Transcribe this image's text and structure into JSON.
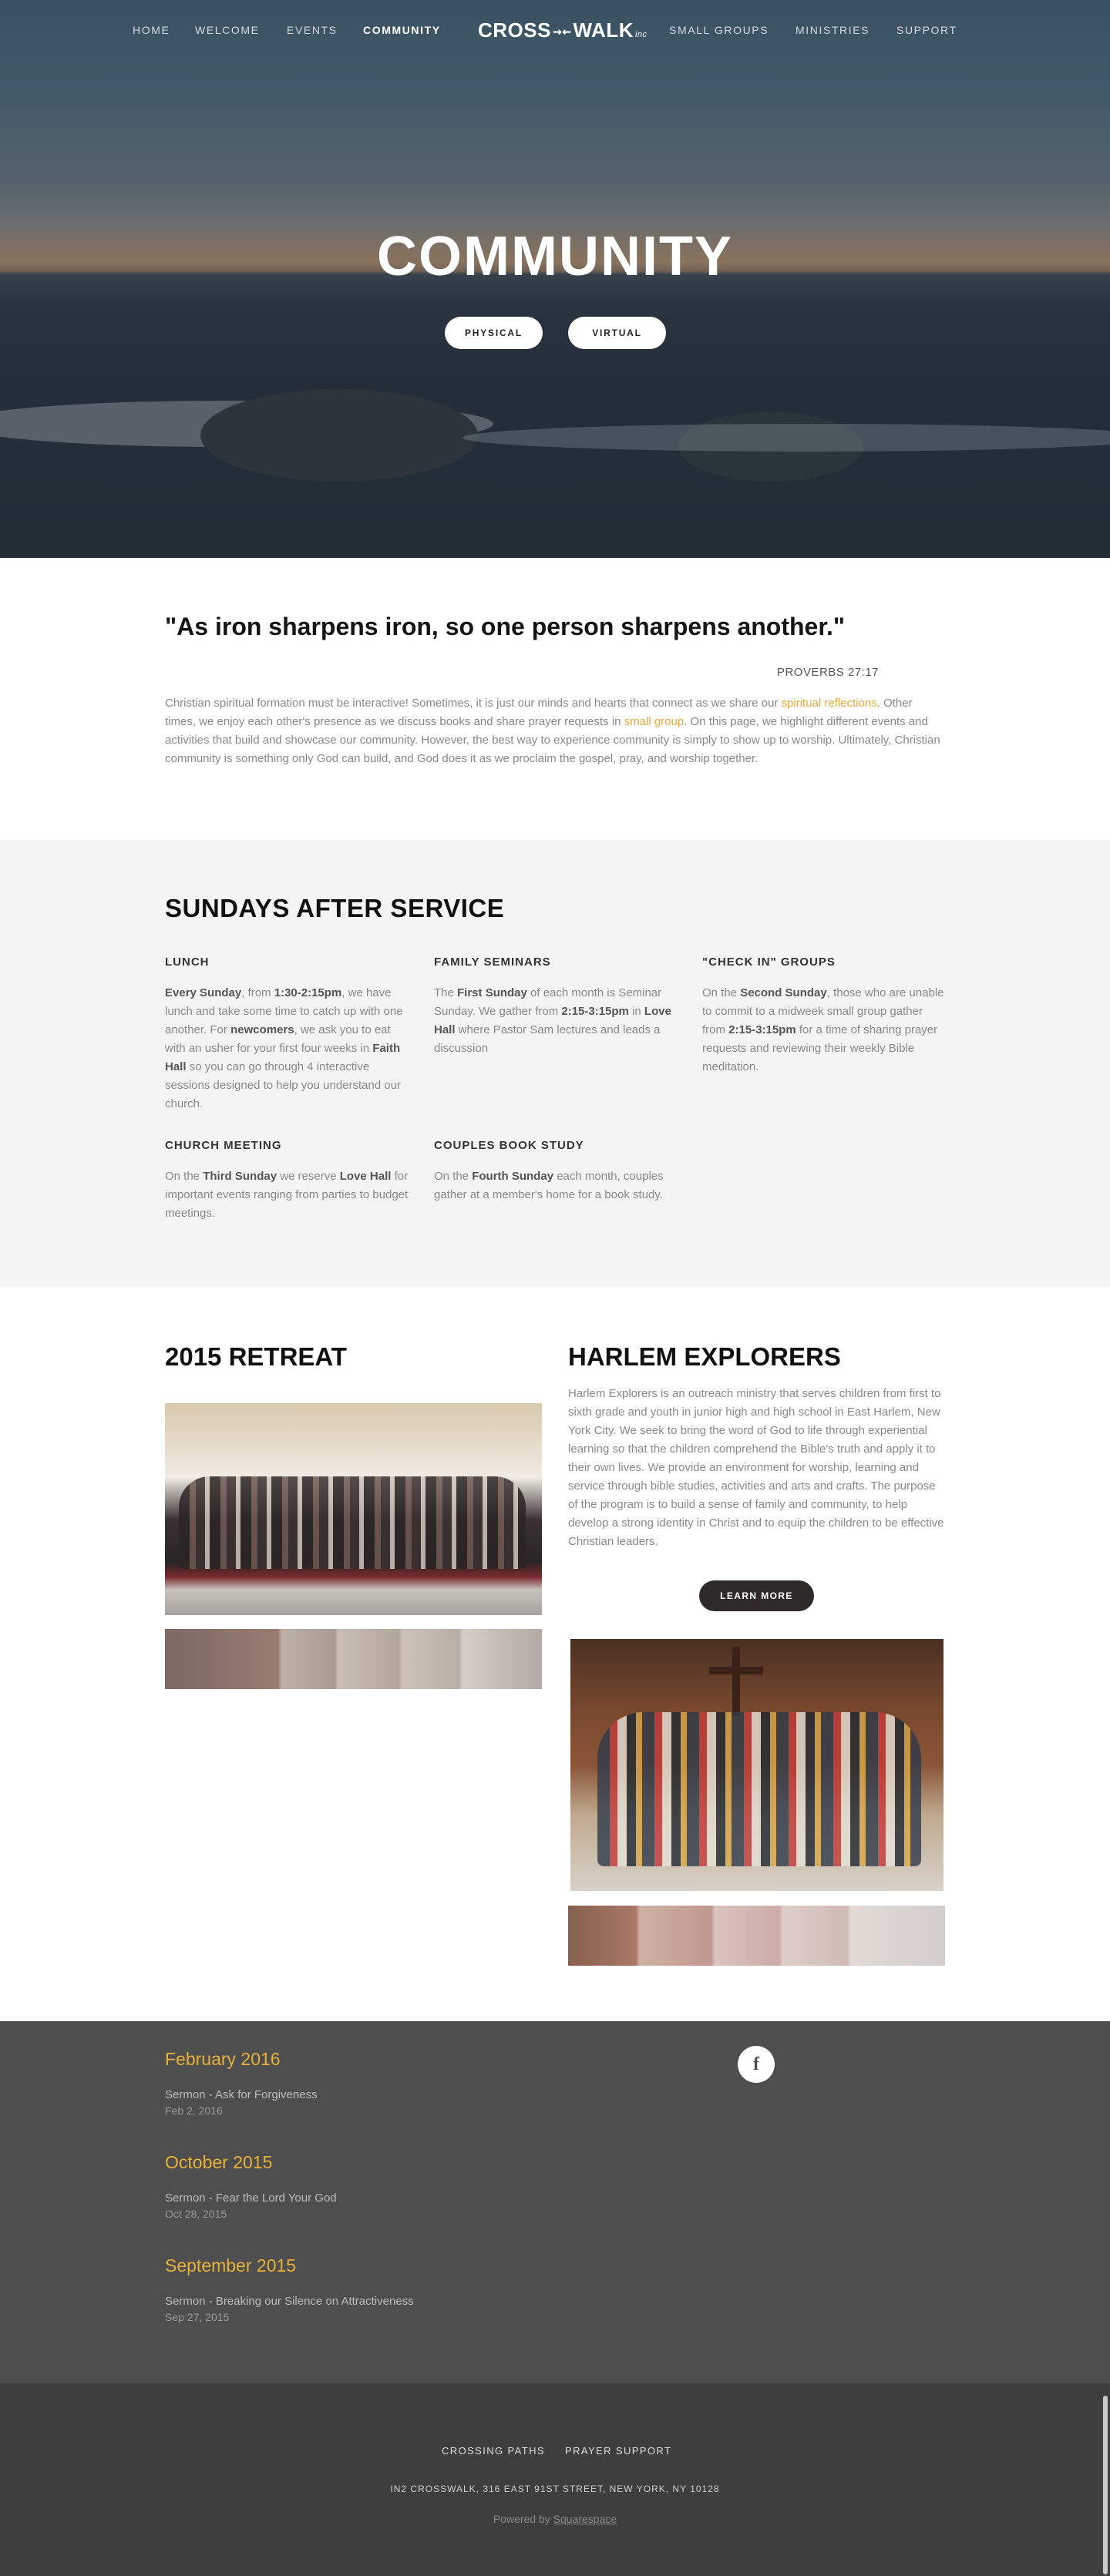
{
  "nav": {
    "items": [
      "HOME",
      "WELCOME",
      "EVENTS",
      "COMMUNITY",
      "SMALL GROUPS",
      "MINISTRIES",
      "SUPPORT"
    ],
    "active": "COMMUNITY",
    "logo": {
      "text": "CROSS",
      "text2": "WALK",
      "mark": "⇝⇜",
      "suffix": "inc"
    }
  },
  "hero": {
    "title": "COMMUNITY",
    "buttons": [
      "PHYSICAL",
      "VIRTUAL"
    ]
  },
  "intro": {
    "quote": "\"As iron sharpens iron, so one person sharpens another.\"",
    "reference": "PROVERBS 27:17",
    "body_1": "Christian spiritual formation must be interactive! Sometimes, it is just our minds and hearts that connect as we share our ",
    "link_1": "spiritual reflections",
    "body_2": ".  Other times, we enjoy each other's presence as we discuss books and share prayer requests in ",
    "link_2": "small group",
    "body_3": ". On this page, we highlight different events and activities that build and showcase our community. However, the best way to experience community is simply to show up to worship. Ultimately, Christian community is something only God can build, and God does it as we proclaim the gospel, pray, and worship together."
  },
  "sundays": {
    "title": "SUNDAYS AFTER SERVICE",
    "lunch": {
      "title": "LUNCH",
      "t1": "Every Sunday",
      "t2": ", from ",
      "t3": "1:30-2:15pm",
      "t4": ", we have lunch and take some time to catch up with one another. For ",
      "t5": "newcomers",
      "t6": ", we ask you to eat with an usher for your first four weeks in ",
      "t7": "Faith Hall",
      "t8": " so you can go through 4 interactive sessions designed to help you understand our church."
    },
    "seminars": {
      "title": "FAMILY SEMINARS",
      "t1": "The ",
      "t2": "First Sunday",
      "t3": " of each month is Seminar Sunday. We gather from ",
      "t4": "2:15-3:15pm",
      "t5": " in ",
      "t6": "Love Hall",
      "t7": " where Pastor Sam lectures and leads a discussion"
    },
    "checkin": {
      "title": "\"CHECK IN\" GROUPS",
      "t1": "On the ",
      "t2": "Second Sunday",
      "t3": ", those who are unable to commit to a midweek small group gather from ",
      "t4": "2:15-3:15pm",
      "t5": " for a time of sharing prayer requests and reviewing their weekly Bible meditation."
    },
    "meeting": {
      "title": "CHURCH MEETING",
      "t1": "On the ",
      "t2": "Third Sunday",
      "t3": " we reserve ",
      "t4": "Love Hall",
      "t5": " for important events ranging from parties to budget meetings."
    },
    "books": {
      "title": "COUPLES BOOK STUDY",
      "t1": "On the ",
      "t2": "Fourth Sunday",
      "t3": " each month, couples gather at a member's home for a book study."
    }
  },
  "retreat": {
    "title": "2015 RETREAT"
  },
  "harlem": {
    "title": "HARLEM EXPLORERS",
    "description": "Harlem Explorers is an outreach ministry that serves children from first to sixth grade and youth in junior high and high school in East Harlem, New York City. We seek to bring the word of God to life through experiential learning so that the children comprehend the Bible's truth and apply it to their own lives. We provide an environment for worship, learning and service through bible studies, activities and arts and crafts. The purpose of the program is to build a sense of family and community, to help develop a strong identity in Christ and to equip the children to be effective Christian leaders.",
    "button": "LEARN MORE"
  },
  "archive": [
    {
      "month": "February 2016",
      "title": "Sermon - Ask for Forgiveness",
      "date": "Feb 2, 2016"
    },
    {
      "month": "October 2015",
      "title": "Sermon - Fear the Lord Your God",
      "date": "Oct 28, 2015"
    },
    {
      "month": "September 2015",
      "title": "Sermon - Breaking our Silence on Attractiveness",
      "date": "Sep 27, 2015"
    }
  ],
  "social": {
    "icon": "facebook-icon",
    "glyph": "f"
  },
  "footer": {
    "links": [
      "CROSSING PATHS",
      "PRAYER SUPPORT"
    ],
    "address": "IN2 CROSSWALK, 316 EAST 91ST STREET, NEW YORK, NY 10128",
    "powered_prefix": "Powered by ",
    "powered_link": "Squarespace"
  },
  "colors": {
    "accent": "#e8a838",
    "archive_bg": "#4e4e4e",
    "footer_bg": "#3e3e3e",
    "section_bg": "#f4f4f4"
  }
}
